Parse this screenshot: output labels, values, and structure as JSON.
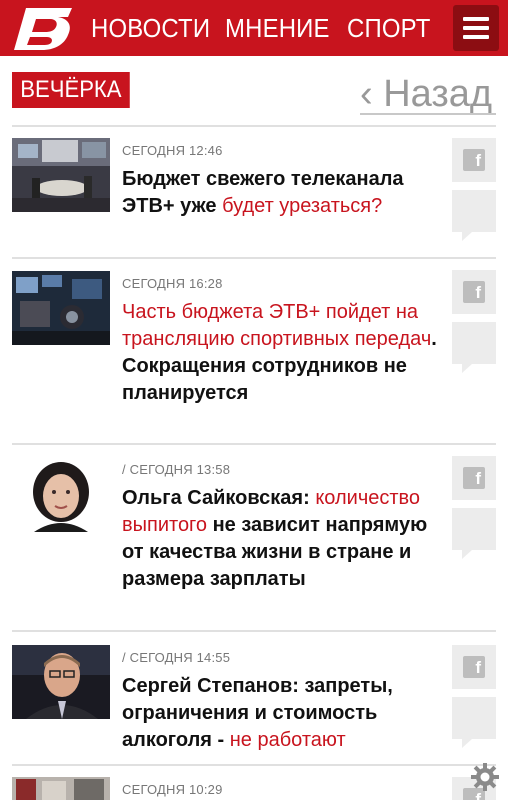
{
  "header": {
    "nav": [
      "НОВОСТИ",
      "МНЕНИЕ",
      "СПОРТ"
    ],
    "menu_icon": "hamburger-icon",
    "brand_color": "#c8141e"
  },
  "section": {
    "label": "ВЕЧЁРКА",
    "back": "‹ Назад"
  },
  "articles": [
    {
      "meta": "СЕГОДНЯ 12:46",
      "title_parts": [
        {
          "text": "Бюджет свежего телеканала ЭТВ+ уже ",
          "accent": false
        },
        {
          "text": "будет урезаться?",
          "accent": true
        }
      ]
    },
    {
      "meta": "СЕГОДНЯ 16:28",
      "title_parts": [
        {
          "text": "Часть бюджета ЭТВ+ пойдет на трансляцию спортивных передач",
          "accent": true
        },
        {
          "text": ". Сокращения сотрудников не планируется",
          "accent": false
        }
      ]
    },
    {
      "meta": "/ СЕГОДНЯ 13:58",
      "title_parts": [
        {
          "text": "Ольга Сайковская: ",
          "accent": false
        },
        {
          "text": "количество выпитого",
          "accent": true
        },
        {
          "text": " не зависит напрямую от качества жизни в стране и размера зарплаты",
          "accent": false
        }
      ]
    },
    {
      "meta": "/ СЕГОДНЯ 14:55",
      "title_parts": [
        {
          "text": "Сергей Степанов: запреты, ограничения и стоимость алкоголя - ",
          "accent": false
        },
        {
          "text": "не работают",
          "accent": true
        }
      ]
    },
    {
      "meta": "СЕГОДНЯ 10:29",
      "title_parts": []
    }
  ],
  "icons": {
    "share": "facebook-icon",
    "comment": "comment-icon",
    "settings": "gear-icon"
  }
}
